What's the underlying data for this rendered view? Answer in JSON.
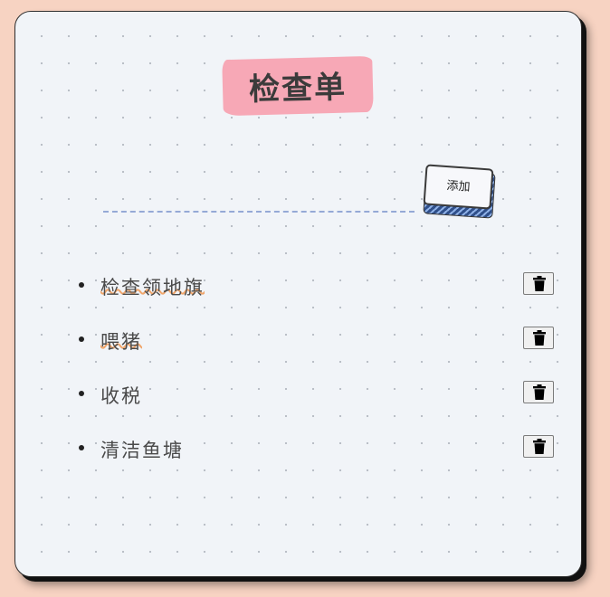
{
  "header": {
    "title": "检查单"
  },
  "add_form": {
    "input_value": "",
    "input_placeholder": "",
    "add_label": "添加"
  },
  "todos": [
    {
      "text": "检查领地旗",
      "done": true,
      "delete_icon": "trash-icon"
    },
    {
      "text": "喂猪",
      "done": true,
      "delete_icon": "trash-icon"
    },
    {
      "text": "收税",
      "done": false,
      "delete_icon": "trash-icon"
    },
    {
      "text": "清洁鱼塘",
      "done": false,
      "delete_icon": "trash-icon"
    }
  ],
  "colors": {
    "page_background": "#f7d3c2",
    "card_background": "#f1f4f8",
    "title_highlight": "#f7a8b6",
    "done_underline": "#f0a56a",
    "input_dash": "#95a9d6",
    "button_stripe": "#2f4f8a"
  }
}
